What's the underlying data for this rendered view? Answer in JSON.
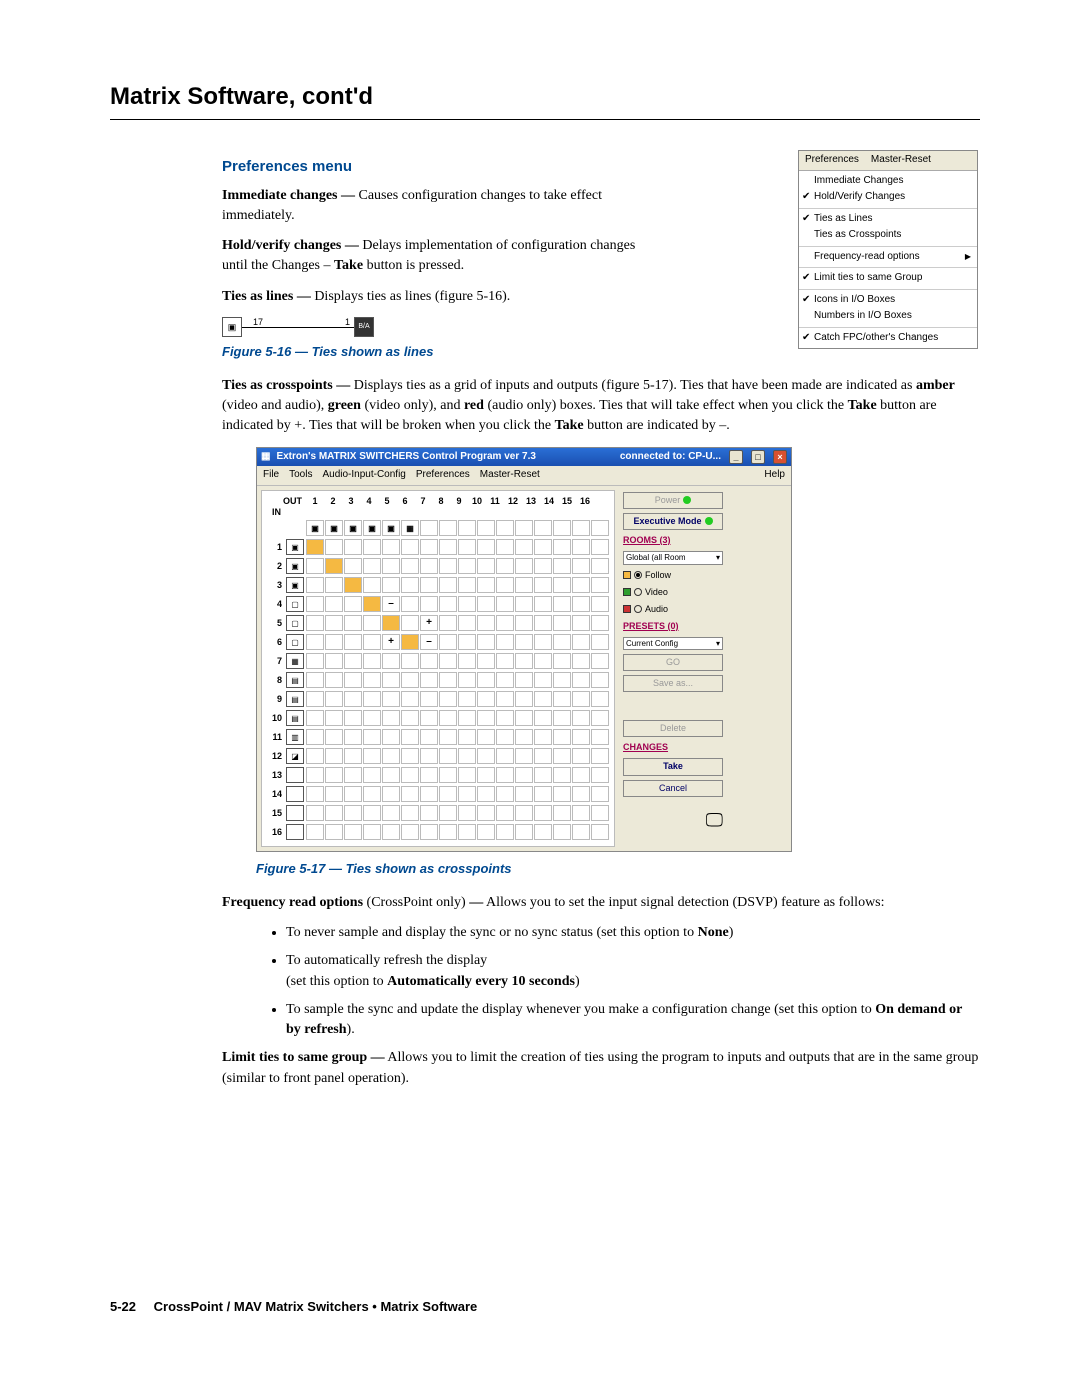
{
  "page_title": "Matrix Software, cont'd",
  "section_heading": "Preferences menu",
  "defs": {
    "immediate_changes_term": "Immediate changes —",
    "immediate_changes_body": " Causes configuration changes to take effect immediately.",
    "hold_verify_term": "Hold/verify changes —",
    "hold_verify_body_1": " Delays implementation of configuration changes until the Changes – ",
    "hold_verify_take": "Take",
    "hold_verify_body_2": " button is pressed.",
    "ties_lines_term": "Ties as lines —",
    "ties_lines_body": " Displays ties as lines (figure 5-16).",
    "ties_crosspoints_term": "Ties as crosspoints —",
    "ties_crosspoints_body_1": " Displays ties as a grid of inputs and outputs (figure 5-17). Ties that have been made are indicated as ",
    "amber": "amber",
    "ties_crosspoints_body_2": " (video and audio), ",
    "green": "green",
    "ties_crosspoints_body_3": " (video only), and ",
    "red": "red",
    "ties_crosspoints_body_4": " (audio only) boxes.  Ties that will take effect when you click the ",
    "take1": "Take",
    "ties_crosspoints_body_5": " button are indicated by +.  Ties that will be broken when you click the ",
    "take2": "Take",
    "ties_crosspoints_body_6": " button are indicated by –.",
    "freq_term": "Frequency read options",
    "freq_paren": " (CrossPoint only) ",
    "freq_dash_body": "— Allows you to set the input signal detection (DSVP) feature as follows:",
    "freq_b1a": "To never sample and display the sync or no sync status (set this option to ",
    "freq_b1b": "None",
    "freq_b1c": ")",
    "freq_b2a": "To automatically refresh the display",
    "freq_b2b": "(set this option to ",
    "freq_b2c": "Automatically every 10 seconds",
    "freq_b2d": ")",
    "freq_b3a": "To sample the sync and update the display whenever you make a configuration change (set this option to ",
    "freq_b3b": "On demand or by refresh",
    "freq_b3c": ").",
    "limit_term": "Limit ties to same group —",
    "limit_body": " Allows you to limit the creation of ties using the program to inputs and outputs that are in the same group (similar to front panel operation)."
  },
  "fig516": {
    "caption": "Figure 5-16 — Ties shown as lines",
    "left_val": "17",
    "right_val": "1"
  },
  "pref_menu": {
    "menubar": [
      "Preferences",
      "Master-Reset"
    ],
    "items": [
      {
        "check": "",
        "label": "Immediate Changes",
        "arrow": false
      },
      {
        "check": "✔",
        "label": "Hold/Verify Changes",
        "arrow": false
      },
      {
        "sep": true
      },
      {
        "check": "✔",
        "label": "Ties as Lines",
        "arrow": false
      },
      {
        "check": "",
        "label": "Ties as Crosspoints",
        "arrow": false
      },
      {
        "sep": true
      },
      {
        "check": "",
        "label": "Frequency-read options",
        "arrow": true
      },
      {
        "sep": true
      },
      {
        "check": "✔",
        "label": "Limit ties to same Group",
        "arrow": false
      },
      {
        "sep": true
      },
      {
        "check": "✔",
        "label": "Icons in I/O Boxes",
        "arrow": false
      },
      {
        "check": "",
        "label": "Numbers in I/O Boxes",
        "arrow": false
      },
      {
        "sep": true
      },
      {
        "check": "✔",
        "label": "Catch FPC/other's Changes",
        "arrow": false
      }
    ]
  },
  "fig517": {
    "caption": "Figure 5-17 — Ties shown as crosspoints",
    "title_left": "Extron's MATRIX SWITCHERS Control Program     ver 7.3",
    "title_right": "connected to:  CP-U...",
    "menubar": [
      "File",
      "Tools",
      "Audio-Input-Config",
      "Preferences",
      "Master-Reset",
      "",
      "Help"
    ],
    "out_label": "OUT",
    "in_label": "IN",
    "col_count": 16,
    "row_count": 16,
    "rows": [
      {
        "icons_row": true,
        "icons": [
          "▣",
          "▣",
          "▣",
          "▣",
          "▣",
          "▦"
        ],
        "rest_empty": true
      },
      {
        "n": 1,
        "icon": "▣",
        "amber": [
          1
        ]
      },
      {
        "n": 2,
        "icon": "▣",
        "amber": [
          2
        ]
      },
      {
        "n": 3,
        "icon": "▣",
        "amber": [
          3
        ]
      },
      {
        "n": 4,
        "icon": "▢",
        "amber": [
          4
        ],
        "minus": [
          5
        ]
      },
      {
        "n": 5,
        "icon": "▢",
        "amber": [
          5
        ],
        "plus": [
          7
        ]
      },
      {
        "n": 6,
        "icon": "▢",
        "amber": [
          6
        ],
        "plus": [
          5
        ],
        "minus": [
          7
        ]
      },
      {
        "n": 7,
        "icon": "▦"
      },
      {
        "n": 8,
        "icon": "▤"
      },
      {
        "n": 9,
        "icon": "▤"
      },
      {
        "n": 10,
        "icon": "▤"
      },
      {
        "n": 11,
        "icon": "▥"
      },
      {
        "n": 12,
        "icon": "◪"
      },
      {
        "n": 13
      },
      {
        "n": 14
      },
      {
        "n": 15
      },
      {
        "n": 16
      }
    ],
    "side": {
      "power": "Power",
      "exec": "Executive Mode",
      "rooms": "ROOMS (3)",
      "rooms_sel": "Global (all Room",
      "follow": "Follow",
      "video": "Video",
      "audio": "Audio",
      "presets": "PRESETS (0)",
      "presets_sel": "Current Config",
      "go": "GO",
      "saveas": "Save as...",
      "delete": "Delete",
      "changes": "CHANGES",
      "take": "Take",
      "cancel": "Cancel"
    }
  },
  "footer": {
    "pagenum": "5-22",
    "text": "CrossPoint / MAV Matrix Switchers • Matrix Software"
  }
}
